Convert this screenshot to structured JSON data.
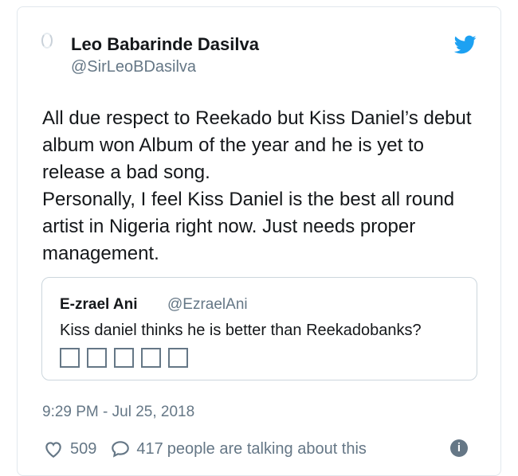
{
  "tweet": {
    "author_name": "Leo Babarinde Dasilva",
    "author_handle": "@SirLeoBDasilva",
    "text_lines": [
      "All due respect to Reekado but Kiss Daniel’s debut album won Album of the year and he is yet to release a bad song.",
      "Personally, I feel Kiss Daniel is the best all round artist in Nigeria right now. Just needs proper management."
    ],
    "timestamp": "9:29 PM - Jul 25, 2018",
    "like_count": "509",
    "talk_count": "417",
    "talk_text": "people are talking about this"
  },
  "quoted_tweet": {
    "author_name": "E-zrael Ani",
    "author_handle": "@EzraelAni",
    "text": "Kiss daniel thinks he is better than Reekadobanks?",
    "emoji_placeholders": 5
  },
  "icons": {
    "brand": "twitter-bird-icon",
    "like": "heart-icon",
    "reply": "speech-bubble-icon",
    "info": "info-icon"
  },
  "colors": {
    "twitter_blue": "#1da1f2",
    "secondary_text": "#657786",
    "border": "#e1e8ed"
  }
}
